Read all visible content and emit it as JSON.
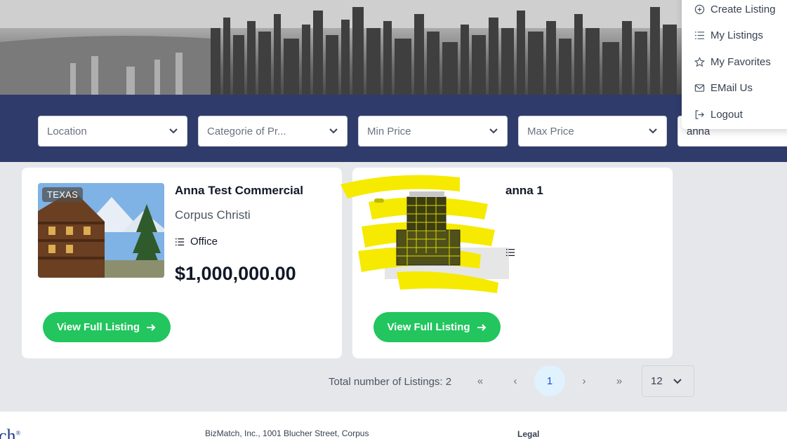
{
  "menu": {
    "items": [
      {
        "label": "Create Listing",
        "icon": "plus-circle-icon"
      },
      {
        "label": "My Listings",
        "icon": "list-icon"
      },
      {
        "label": "My Favorites",
        "icon": "star-icon"
      },
      {
        "label": "EMail Us",
        "icon": "envelope-icon"
      },
      {
        "label": "Logout",
        "icon": "logout-icon"
      }
    ]
  },
  "filters": {
    "location": "Location",
    "category": "Categorie of Pr...",
    "min_price": "Min Price",
    "max_price": "Max Price",
    "search_value": "anna"
  },
  "listings": [
    {
      "badge": "TEXAS",
      "title": "Anna Test Commercial",
      "city": "Corpus Christi",
      "category": "Office",
      "price": "$1,000,000.00",
      "button": "View Full Listing"
    },
    {
      "badge": "",
      "title": "anna 1",
      "city": "",
      "category": "",
      "price": "",
      "button": "View Full Listing"
    }
  ],
  "pagination": {
    "total_text": "Total number of Listings: 2",
    "first": "«",
    "prev": "‹",
    "current": "1",
    "next": "›",
    "last": "»",
    "per_page": "12"
  },
  "footer": {
    "logo_fragment": "ch",
    "logo_mark": "®",
    "address": "BizMatch, Inc., 1001 Blucher Street, Corpus",
    "legal": "Legal"
  },
  "colors": {
    "filter_bar": "#2f3b6b",
    "button": "#22c55e",
    "page_bg": "#e5e7eb"
  }
}
